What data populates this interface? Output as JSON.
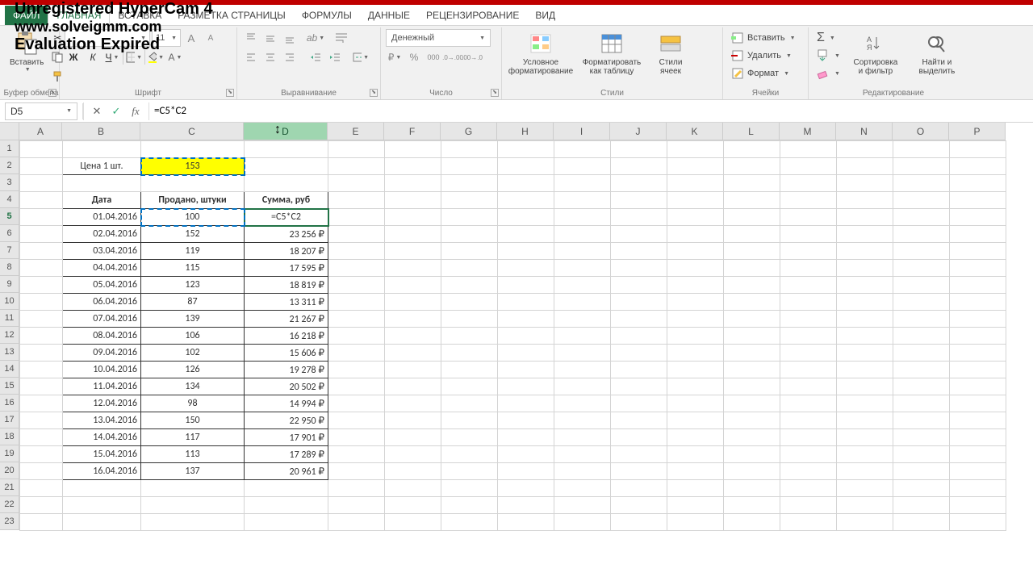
{
  "overlay": {
    "l1": "Unregistered HyperCam 4",
    "l2": "www.solveigmm.com",
    "l3": "Evaluation Expired"
  },
  "tabs": {
    "file": "ФАЙЛ",
    "home": "ГЛАВНАЯ",
    "insert": "ВСТАВКА",
    "layout": "РАЗМЕТКА СТРАНИЦЫ",
    "formulas": "ФОРМУЛЫ",
    "data": "ДАННЫЕ",
    "review": "РЕЦЕНЗИРОВАНИЕ",
    "view": "ВИД"
  },
  "groups": {
    "clipboard": "Буфер обмена",
    "font": "Шрифт",
    "alignment": "Выравнивание",
    "number": "Число",
    "styles": "Стили",
    "cells": "Ячейки",
    "editing": "Редактирование"
  },
  "ribbon": {
    "paste": "Вставить",
    "font_name": "",
    "font_size": "11",
    "bold": "Ж",
    "italic": "К",
    "underline": "Ч",
    "number_format": "Денежный",
    "cond_format": "Условное\nформатирование",
    "format_table": "Форматировать\nкак таблицу",
    "cell_styles": "Стили\nячеек",
    "insert_cell": "Вставить",
    "delete_cell": "Удалить",
    "format_cell": "Формат",
    "sort_filter": "Сортировка\nи фильтр",
    "find_select": "Найти и\nвыделить"
  },
  "namebox": "D5",
  "formula": "=C5*C2",
  "columns": [
    "A",
    "B",
    "C",
    "D",
    "E",
    "F",
    "G",
    "H",
    "I",
    "J",
    "K",
    "L",
    "M",
    "N",
    "O",
    "P"
  ],
  "sheet": {
    "price_label": "Цена 1 шт.",
    "price_value": "153",
    "h_date": "Дата",
    "h_qty": "Продано, штуки",
    "h_sum": "Сумма, руб",
    "d5_formula": "=C5*C2",
    "rows": [
      {
        "date": "01.04.2016",
        "qty": "100",
        "sum": "=C5*C2"
      },
      {
        "date": "02.04.2016",
        "qty": "152",
        "sum": "23 256 ₽"
      },
      {
        "date": "03.04.2016",
        "qty": "119",
        "sum": "18 207 ₽"
      },
      {
        "date": "04.04.2016",
        "qty": "115",
        "sum": "17 595 ₽"
      },
      {
        "date": "05.04.2016",
        "qty": "123",
        "sum": "18 819 ₽"
      },
      {
        "date": "06.04.2016",
        "qty": "87",
        "sum": "13 311 ₽"
      },
      {
        "date": "07.04.2016",
        "qty": "139",
        "sum": "21 267 ₽"
      },
      {
        "date": "08.04.2016",
        "qty": "106",
        "sum": "16 218 ₽"
      },
      {
        "date": "09.04.2016",
        "qty": "102",
        "sum": "15 606 ₽"
      },
      {
        "date": "10.04.2016",
        "qty": "126",
        "sum": "19 278 ₽"
      },
      {
        "date": "11.04.2016",
        "qty": "134",
        "sum": "20 502 ₽"
      },
      {
        "date": "12.04.2016",
        "qty": "98",
        "sum": "14 994 ₽"
      },
      {
        "date": "13.04.2016",
        "qty": "150",
        "sum": "22 950 ₽"
      },
      {
        "date": "14.04.2016",
        "qty": "117",
        "sum": "17 901 ₽"
      },
      {
        "date": "15.04.2016",
        "qty": "113",
        "sum": "17 289 ₽"
      },
      {
        "date": "16.04.2016",
        "qty": "137",
        "sum": "20 961 ₽"
      }
    ]
  }
}
